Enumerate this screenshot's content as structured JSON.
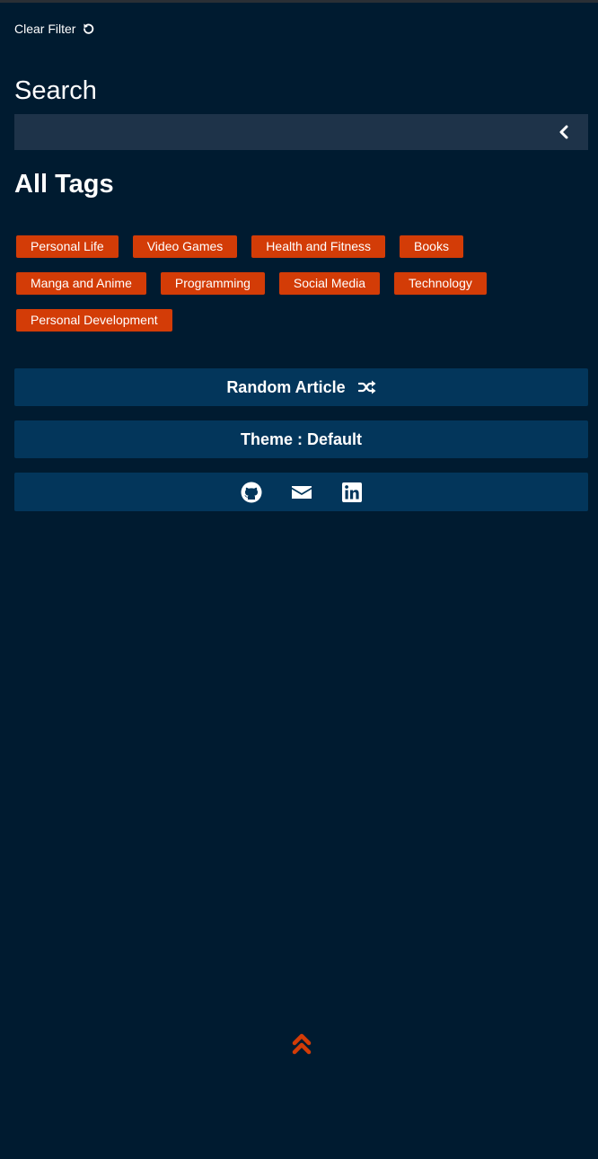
{
  "filters": {
    "clear_label": "Clear Filter",
    "clear_icon": "rotate-left-icon"
  },
  "search": {
    "heading": "Search",
    "value": "",
    "placeholder": "",
    "toggle_icon": "chevron-left-icon"
  },
  "tags": {
    "heading": "All Tags",
    "rows": [
      [
        "Personal Life",
        "Video Games",
        "Health and Fitness",
        "Books"
      ],
      [
        "Manga and Anime",
        "Programming",
        "Social Media",
        "Technology"
      ],
      [
        "Personal Development"
      ]
    ]
  },
  "actions": {
    "random_label": "Random Article",
    "random_icon": "shuffle-icon",
    "theme_label": "Theme : Default"
  },
  "social": [
    "github-icon",
    "envelope-icon",
    "linkedin-icon"
  ],
  "scroll_top_icon": "double-chevron-up-icon",
  "colors": {
    "background": "#001b30",
    "panel": "#03365b",
    "search_bar": "#1e3349",
    "tag": "#d33c07",
    "accent": "#d33c07",
    "text": "#ffffff"
  }
}
